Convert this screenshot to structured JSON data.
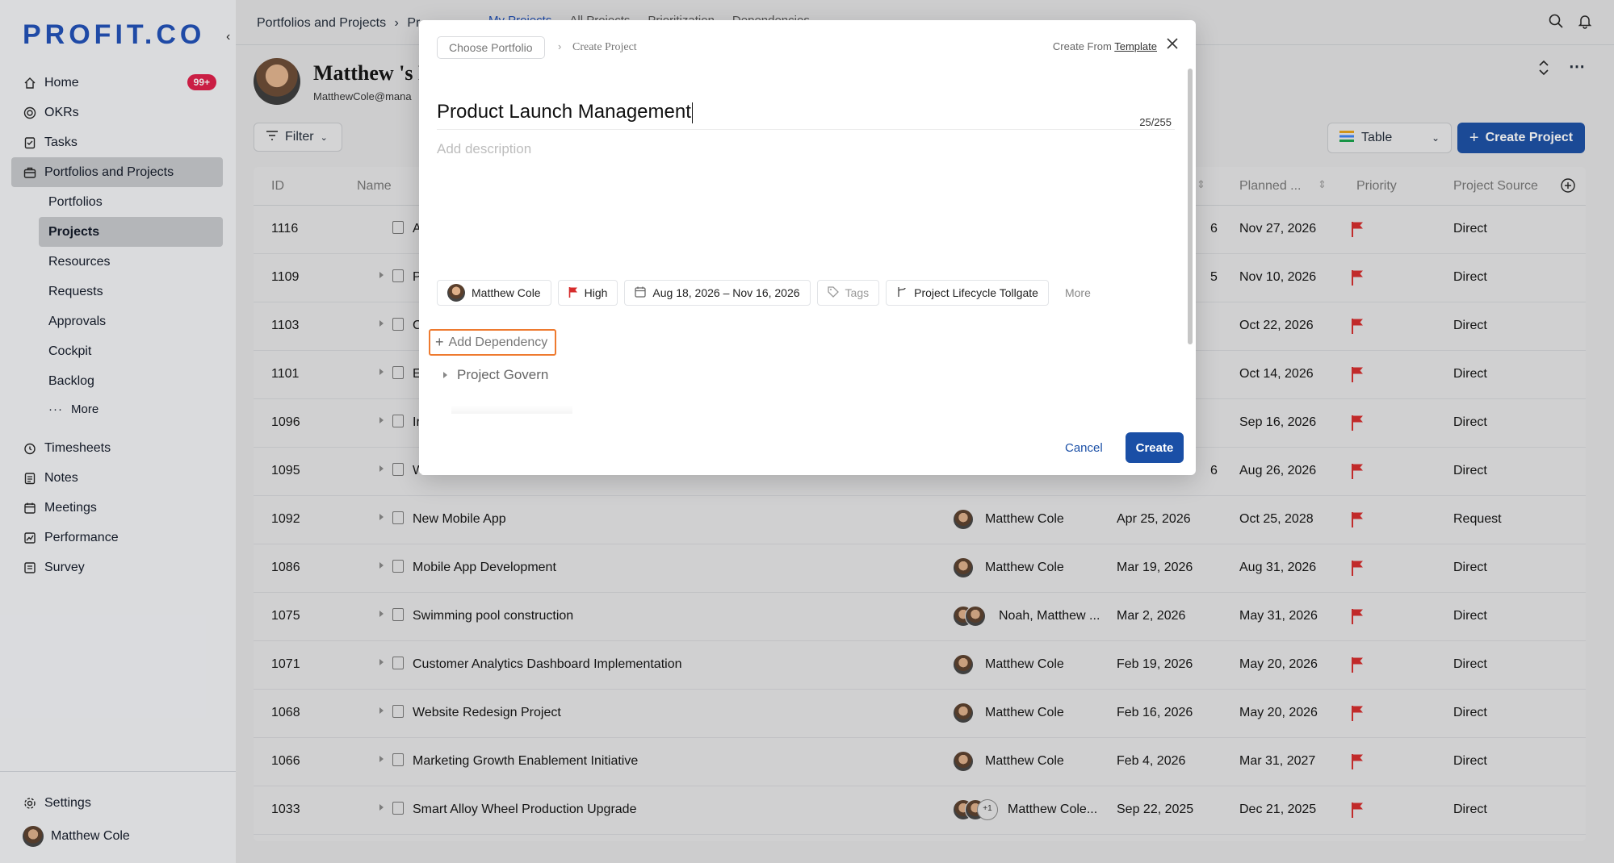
{
  "brand": {
    "logo": "PROFIT.CO"
  },
  "sidebar": {
    "items": [
      {
        "label": "Home",
        "badge": "99+"
      },
      {
        "label": "OKRs"
      },
      {
        "label": "Tasks"
      },
      {
        "label": "Portfolios and Projects"
      }
    ],
    "subitems": [
      "Portfolios",
      "Projects",
      "Resources",
      "Requests",
      "Approvals",
      "Cockpit",
      "Backlog"
    ],
    "more_label": "More",
    "items2": [
      "Timesheets",
      "Notes",
      "Meetings",
      "Performance",
      "Survey"
    ],
    "settings_label": "Settings",
    "user_name": "Matthew Cole"
  },
  "topbar": {
    "breadcrumb": "Portfolios and Projects",
    "breadcrumb_next": "Pr",
    "tabs": [
      "My Projects",
      "All Projects",
      "Prioritization",
      "Dependencies"
    ]
  },
  "owner": {
    "name": "Matthew 's P",
    "email": "MatthewCole@mana"
  },
  "toolbar": {
    "filter_label": "Filter",
    "view_label": "Table",
    "create_label": "Create Project"
  },
  "grid": {
    "headers": {
      "id": "ID",
      "name": "Name",
      "planned": "Planned ...",
      "priority": "Priority",
      "source": "Project Source"
    },
    "rows": [
      {
        "id": "1116",
        "name": "A",
        "owner": "",
        "start": "6",
        "planned": "Nov 27, 2026",
        "source": "Direct"
      },
      {
        "id": "1109",
        "name": "P",
        "owner": "",
        "start": "5",
        "planned": "Nov 10, 2026",
        "source": "Direct"
      },
      {
        "id": "1103",
        "name": "C",
        "owner": "",
        "start": "",
        "planned": "Oct 22, 2026",
        "source": "Direct"
      },
      {
        "id": "1101",
        "name": "E",
        "owner": "",
        "start": "",
        "planned": "Oct 14, 2026",
        "source": "Direct"
      },
      {
        "id": "1096",
        "name": "Ir",
        "owner": "",
        "start": "",
        "planned": "Sep 16, 2026",
        "source": "Direct"
      },
      {
        "id": "1095",
        "name": "W",
        "owner": "",
        "start": "6",
        "planned": "Aug 26, 2026",
        "source": "Direct"
      },
      {
        "id": "1092",
        "name": "New Mobile App",
        "owner": "Matthew Cole",
        "start": "Apr 25, 2026",
        "planned": "Oct 25, 2028",
        "source": "Request"
      },
      {
        "id": "1086",
        "name": "Mobile App Development",
        "owner": "Matthew Cole",
        "start": "Mar 19, 2026",
        "planned": "Aug 31, 2026",
        "source": "Direct"
      },
      {
        "id": "1075",
        "name": "Swimming pool construction",
        "owner": "Noah, Matthew ...",
        "start": "Mar 2, 2026",
        "planned": "May 31, 2026",
        "source": "Direct"
      },
      {
        "id": "1071",
        "name": "Customer Analytics Dashboard Implementation",
        "owner": "Matthew Cole",
        "start": "Feb 19, 2026",
        "planned": "May 20, 2026",
        "source": "Direct"
      },
      {
        "id": "1068",
        "name": "Website Redesign Project",
        "owner": "Matthew Cole",
        "start": "Feb 16, 2026",
        "planned": "May 20, 2026",
        "source": "Direct"
      },
      {
        "id": "1066",
        "name": "Marketing Growth Enablement Initiative",
        "owner": "Matthew Cole",
        "start": "Feb 4, 2026",
        "planned": "Mar 31, 2027",
        "source": "Direct"
      },
      {
        "id": "1033",
        "name": "Smart Alloy Wheel Production Upgrade",
        "owner": "Matthew Cole...",
        "start": "Sep 22, 2025",
        "planned": "Dec 21, 2025",
        "source": "Direct"
      }
    ],
    "extra_owner_badge": "+1"
  },
  "modal": {
    "choose_portfolio": "Choose Portfolio",
    "step": "Create Project",
    "create_from": "Create From ",
    "template_link": "Template",
    "title_value": "Product Launch Management",
    "char_count": "25/255",
    "description_placeholder": "Add description",
    "chips": {
      "owner": "Matthew Cole",
      "priority": "High",
      "dates": "Aug 18, 2026 – Nov 16, 2026",
      "tags": "Tags",
      "lifecycle": "Project Lifecycle Tollgate",
      "more": "More"
    },
    "add_dependency": "Add Dependency",
    "section": "Project Govern",
    "cancel_label": "Cancel",
    "create_label": "Create"
  },
  "colors": {
    "primary": "#1a4fa6",
    "flag": "#d62b2b",
    "highlight": "#ee7a2f",
    "badge": "#e11d48"
  }
}
